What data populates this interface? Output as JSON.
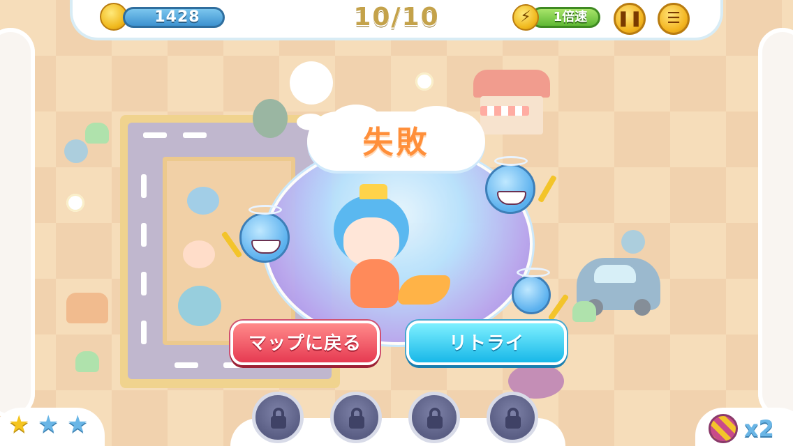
{
  "hud": {
    "coins": "1428",
    "wave": "10/10",
    "speed_icon": "lightning-icon",
    "speed_label": "1倍速",
    "pause_icon": "pause-icon",
    "menu_icon": "menu-list-icon"
  },
  "dialog": {
    "title": "失敗",
    "back_to_map_label": "マップに戻る",
    "retry_label": "リトライ"
  },
  "bottom": {
    "stars_earned": 1,
    "stars_total": 3,
    "item_count": "x2",
    "locked_slots": 4
  },
  "colors": {
    "fail_title": "#ff8f3a",
    "map_button": "#e63a52",
    "retry_button": "#18b8e8",
    "star_filled": "#f5c520",
    "star_empty": "#6ab6e6"
  }
}
